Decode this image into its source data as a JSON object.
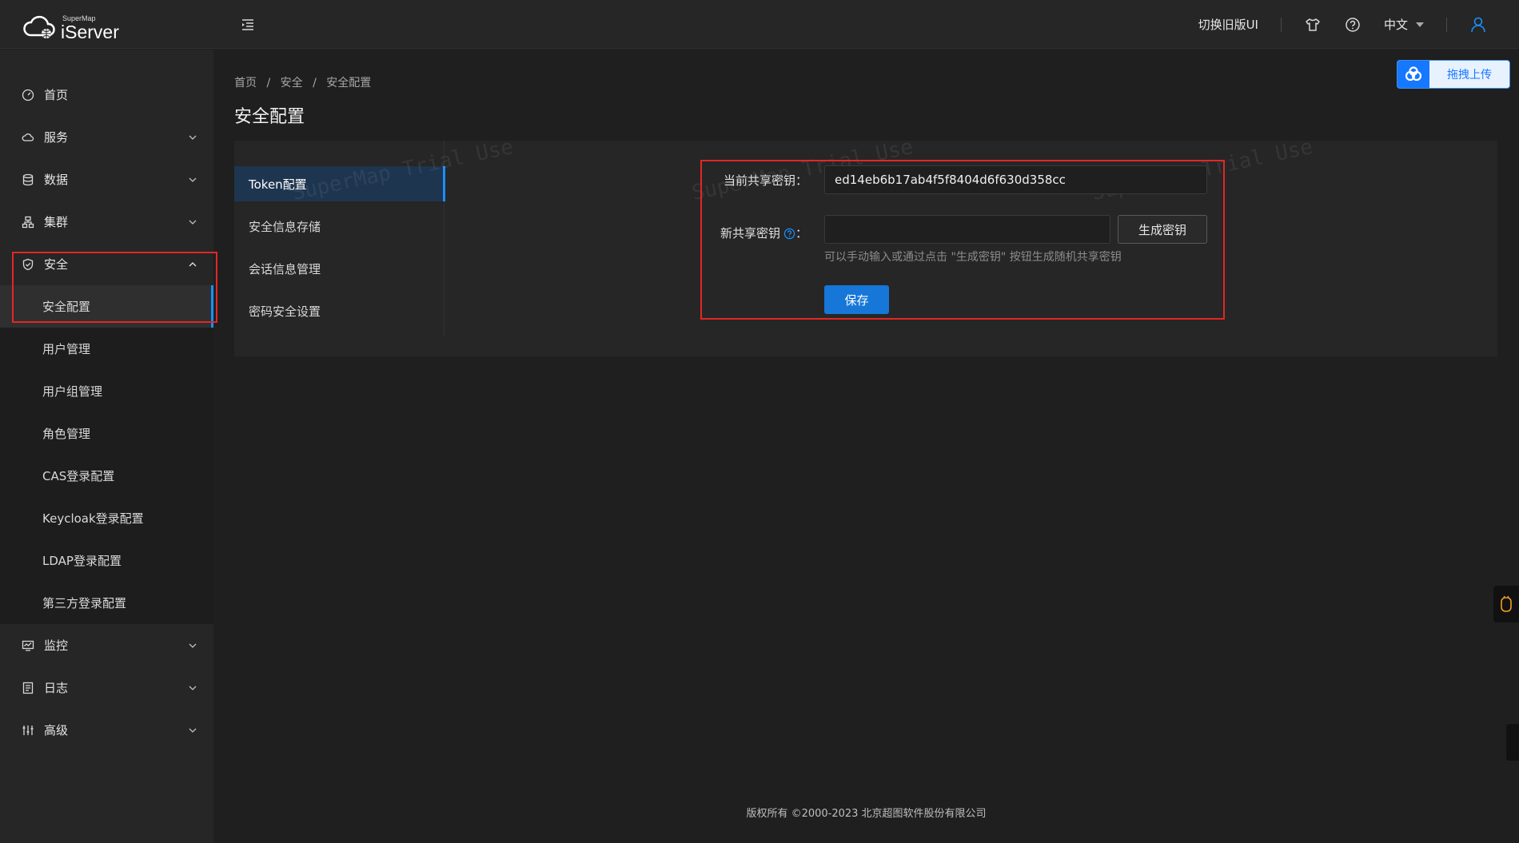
{
  "header": {
    "brand_small": "SuperMap",
    "brand_main": "iServer",
    "switch_ui": "切换旧版UI",
    "language": "中文"
  },
  "sidebar": {
    "items": [
      {
        "label": "首页"
      },
      {
        "label": "服务"
      },
      {
        "label": "数据"
      },
      {
        "label": "集群"
      },
      {
        "label": "安全"
      },
      {
        "label": "监控"
      },
      {
        "label": "日志"
      },
      {
        "label": "高级"
      }
    ],
    "security_sub": [
      {
        "label": "安全配置",
        "active": true
      },
      {
        "label": "用户管理"
      },
      {
        "label": "用户组管理"
      },
      {
        "label": "角色管理"
      },
      {
        "label": "CAS登录配置"
      },
      {
        "label": "Keycloak登录配置"
      },
      {
        "label": "LDAP登录配置"
      },
      {
        "label": "第三方登录配置"
      }
    ]
  },
  "breadcrumb": [
    "首页",
    "安全",
    "安全配置"
  ],
  "page_title": "安全配置",
  "upload_button": "拖拽上传",
  "tabs": [
    {
      "label": "Token配置",
      "active": true
    },
    {
      "label": "安全信息存储"
    },
    {
      "label": "会话信息管理"
    },
    {
      "label": "密码安全设置"
    }
  ],
  "watermark": "SuperMap Trial Use",
  "form": {
    "current_key_label": "当前共享密钥",
    "current_key_value": "ed14eb6b17ab4f5f8404d6f630d358cc",
    "new_key_label": "新共享密钥",
    "colon": "：",
    "new_key_value": "",
    "generate_button": "生成密钥",
    "hint": "可以手动输入或通过点击 \"生成密钥\" 按钮生成随机共享密钥",
    "save_button": "保存"
  },
  "footer": "版权所有 ©2000-2023 北京超图软件股份有限公司",
  "colors": {
    "accent": "#1890ff",
    "highlight_box": "#e32626"
  }
}
